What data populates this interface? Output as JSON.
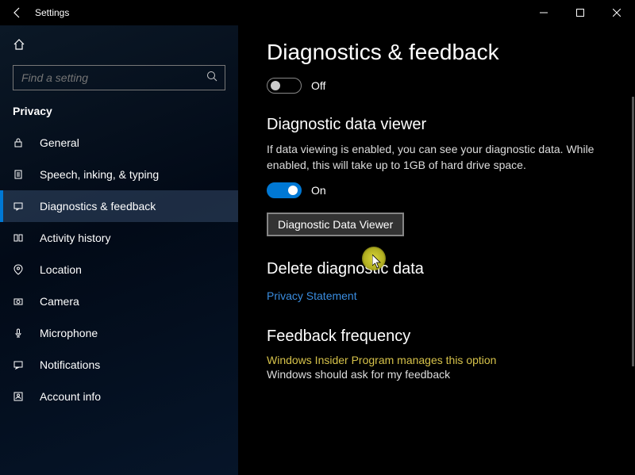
{
  "window": {
    "title": "Settings"
  },
  "sidebar": {
    "search_placeholder": "Find a setting",
    "category": "Privacy",
    "items": [
      {
        "label": "General"
      },
      {
        "label": "Speech, inking, & typing"
      },
      {
        "label": "Diagnostics & feedback"
      },
      {
        "label": "Activity history"
      },
      {
        "label": "Location"
      },
      {
        "label": "Camera"
      },
      {
        "label": "Microphone"
      },
      {
        "label": "Notifications"
      },
      {
        "label": "Account info"
      }
    ]
  },
  "main": {
    "title": "Diagnostics & feedback",
    "top_toggle": {
      "state": "Off"
    },
    "viewer": {
      "heading": "Diagnostic data viewer",
      "desc": "If data viewing is enabled, you can see your diagnostic data. While enabled, this will take up to 1GB of hard drive space.",
      "toggle_state": "On",
      "button": "Diagnostic Data Viewer"
    },
    "delete": {
      "heading": "Delete diagnostic data",
      "link": "Privacy Statement"
    },
    "feedback": {
      "heading": "Feedback frequency",
      "insider": "Windows Insider Program manages this option",
      "sub": "Windows should ask for my feedback"
    }
  }
}
